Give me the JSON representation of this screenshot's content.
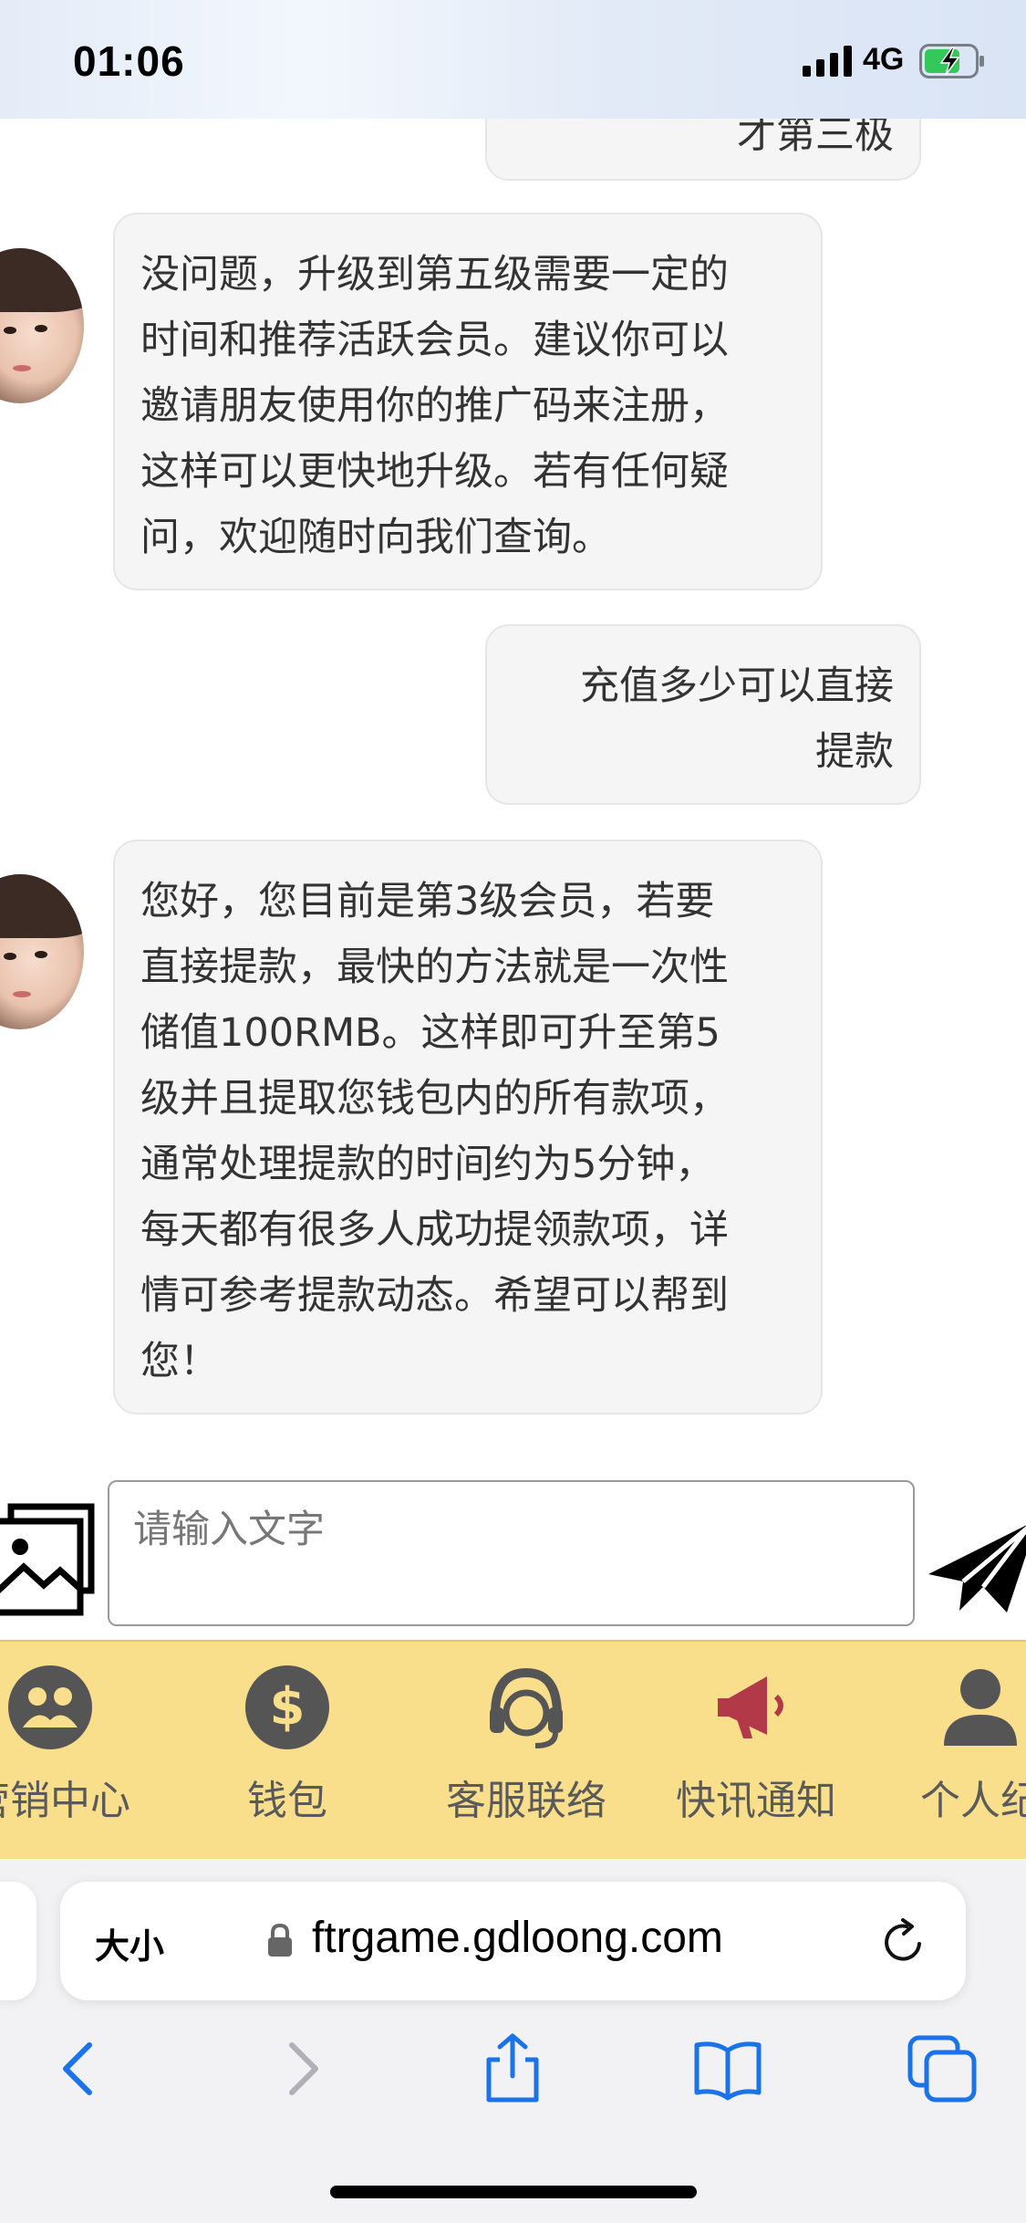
{
  "status_bar": {
    "time": "01:06",
    "network": "4G"
  },
  "chat": {
    "partial_user_message": "才第三极",
    "messages": [
      {
        "sender": "agent",
        "lines": [
          "没问题，升级到第五级需要一定的",
          "时间和推荐活跃会员。建议你可以",
          "邀请朋友使用你的推广码来注册，",
          "这样可以更快地升级。若有任何疑",
          "问，欢迎随时向我们查询。"
        ]
      },
      {
        "sender": "user",
        "lines": [
          "充值多少可以直接",
          "提款"
        ]
      },
      {
        "sender": "agent",
        "lines": [
          "您好，您目前是第3级会员，若要",
          "直接提款，最快的方法就是一次性",
          "储值100RMB。这样即可升至第5",
          "级并且提取您钱包内的所有款项，",
          "通常处理提款的时间约为5分钟，",
          "每天都有很多人成功提领款项，详",
          "情可参考提款动态。希望可以帮到",
          "您！"
        ]
      }
    ]
  },
  "input": {
    "placeholder": "请输入文字"
  },
  "bottom_nav": {
    "items": [
      {
        "label": "营销中心",
        "icon": "marketing-icon"
      },
      {
        "label": "钱包",
        "icon": "dollar-icon"
      },
      {
        "label": "客服联络",
        "icon": "headset-icon"
      },
      {
        "label": "快讯通知",
        "icon": "megaphone-icon"
      },
      {
        "label": "个人纪",
        "icon": "person-icon"
      }
    ],
    "background": "#f9df8c"
  },
  "browser": {
    "text_size_label": "大小",
    "url": "ftrgame.gdloong.com"
  },
  "colors": {
    "ios_blue": "#1a73e8",
    "megaphone_red": "#b23a48"
  }
}
